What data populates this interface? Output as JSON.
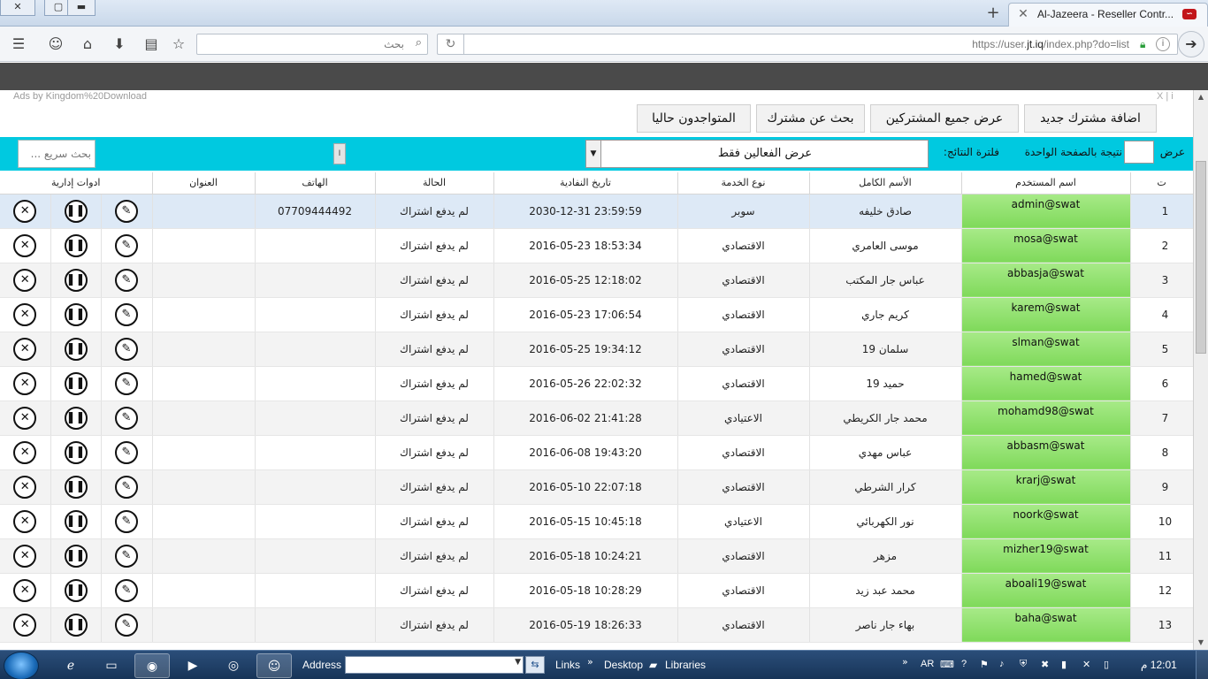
{
  "browser": {
    "tab_title": "Al-Jazeera - Reseller Contr...",
    "tab_favicon_text": "∽",
    "url_prefix": "https://user.",
    "url_domain": "jt.iq",
    "url_path": "/index.php?do=list",
    "search_placeholder": "بحث",
    "newtab_label": "+",
    "close_label": "✕"
  },
  "page": {
    "ads_text": "Ads by Kingdom%20Download",
    "ads_close": "X | i",
    "nav": {
      "add_subscriber": "اضافة مشترك جديد",
      "show_all": "عرض جميع المشتركين",
      "search_subscriber": "بحث عن مشترك",
      "online_now": "المتواجدون حاليا"
    },
    "filter": {
      "quick_search_placeholder": "بحث سريع ...",
      "toggle_label": "I",
      "select_value": "عرض الفعالين فقط",
      "filter_label": "فلترة النتائج:",
      "perpage_label": "نتيجة بالصفحة الواحدة",
      "perpage_value": "",
      "show_label": "عرض"
    },
    "table": {
      "headers": {
        "num": "ت",
        "username": "اسم المستخدم",
        "fullname": "الأسم الكامل",
        "service": "نوع الخدمة",
        "expiry": "تاريخ النفادية",
        "status": "الحالة",
        "phone": "الهاتف",
        "address": "العنوان",
        "tools": "ادوات إدارية"
      },
      "rows": [
        {
          "num": "1",
          "username": "admin@swat",
          "fullname": "صادق خليفه",
          "service": "سوبر",
          "expiry": "2030-12-31 23:59:59",
          "status": "لم يدفع اشتراك",
          "phone": "07709444492",
          "address": ""
        },
        {
          "num": "2",
          "username": "mosa@swat",
          "fullname": "موسى العامري",
          "service": "الاقتصادي",
          "expiry": "2016-05-23 18:53:34",
          "status": "لم يدفع اشتراك",
          "phone": "",
          "address": ""
        },
        {
          "num": "3",
          "username": "abbasja@swat",
          "fullname": "عباس جار المكتب",
          "service": "الاقتصادي",
          "expiry": "2016-05-25 12:18:02",
          "status": "لم يدفع اشتراك",
          "phone": "",
          "address": ""
        },
        {
          "num": "4",
          "username": "karem@swat",
          "fullname": "كريم جاري",
          "service": "الاقتصادي",
          "expiry": "2016-05-23 17:06:54",
          "status": "لم يدفع اشتراك",
          "phone": "",
          "address": ""
        },
        {
          "num": "5",
          "username": "slman@swat",
          "fullname": "سلمان 19",
          "service": "الاقتصادي",
          "expiry": "2016-05-25 19:34:12",
          "status": "لم يدفع اشتراك",
          "phone": "",
          "address": ""
        },
        {
          "num": "6",
          "username": "hamed@swat",
          "fullname": "حميد 19",
          "service": "الاقتصادي",
          "expiry": "2016-05-26 22:02:32",
          "status": "لم يدفع اشتراك",
          "phone": "",
          "address": ""
        },
        {
          "num": "7",
          "username": "mohamd98@swat",
          "fullname": "محمد جار الكريطي",
          "service": "الاعتيادي",
          "expiry": "2016-06-02 21:41:28",
          "status": "لم يدفع اشتراك",
          "phone": "",
          "address": ""
        },
        {
          "num": "8",
          "username": "abbasm@swat",
          "fullname": "عباس مهدي",
          "service": "الاقتصادي",
          "expiry": "2016-06-08 19:43:20",
          "status": "لم يدفع اشتراك",
          "phone": "",
          "address": ""
        },
        {
          "num": "9",
          "username": "krarj@swat",
          "fullname": "كرار الشرطي",
          "service": "الاقتصادي",
          "expiry": "2016-05-10 22:07:18",
          "status": "لم يدفع اشتراك",
          "phone": "",
          "address": ""
        },
        {
          "num": "10",
          "username": "noork@swat",
          "fullname": "نور الكهربائي",
          "service": "الاعتيادي",
          "expiry": "2016-05-15 10:45:18",
          "status": "لم يدفع اشتراك",
          "phone": "",
          "address": ""
        },
        {
          "num": "11",
          "username": "mizher19@swat",
          "fullname": "مزهر",
          "service": "الاقتصادي",
          "expiry": "2016-05-18 10:24:21",
          "status": "لم يدفع اشتراك",
          "phone": "",
          "address": ""
        },
        {
          "num": "12",
          "username": "aboali19@swat",
          "fullname": "محمد عبد زيد",
          "service": "الاقتصادي",
          "expiry": "2016-05-18 10:28:29",
          "status": "لم يدفع اشتراك",
          "phone": "",
          "address": ""
        },
        {
          "num": "13",
          "username": "baha@swat",
          "fullname": "بهاء جار ناصر",
          "service": "الاقتصادي",
          "expiry": "2016-05-19 18:26:33",
          "status": "لم يدفع اشتراك",
          "phone": "",
          "address": ""
        }
      ],
      "highlighted_row": 1
    },
    "icons": {
      "edit": "edit-icon",
      "pause": "pause-icon",
      "delete": "delete-icon"
    }
  },
  "taskbar": {
    "address_label": "Address",
    "links_label": "Links",
    "desktop_label": "Desktop",
    "libraries_label": "Libraries",
    "lang": "AR",
    "clock": "12:01 م"
  },
  "colors": {
    "filter_bar": "#00c9e0",
    "username_cell": "#8ee06a",
    "highlight_row": "#dde9f6",
    "dark_band": "#4a4a4a"
  }
}
